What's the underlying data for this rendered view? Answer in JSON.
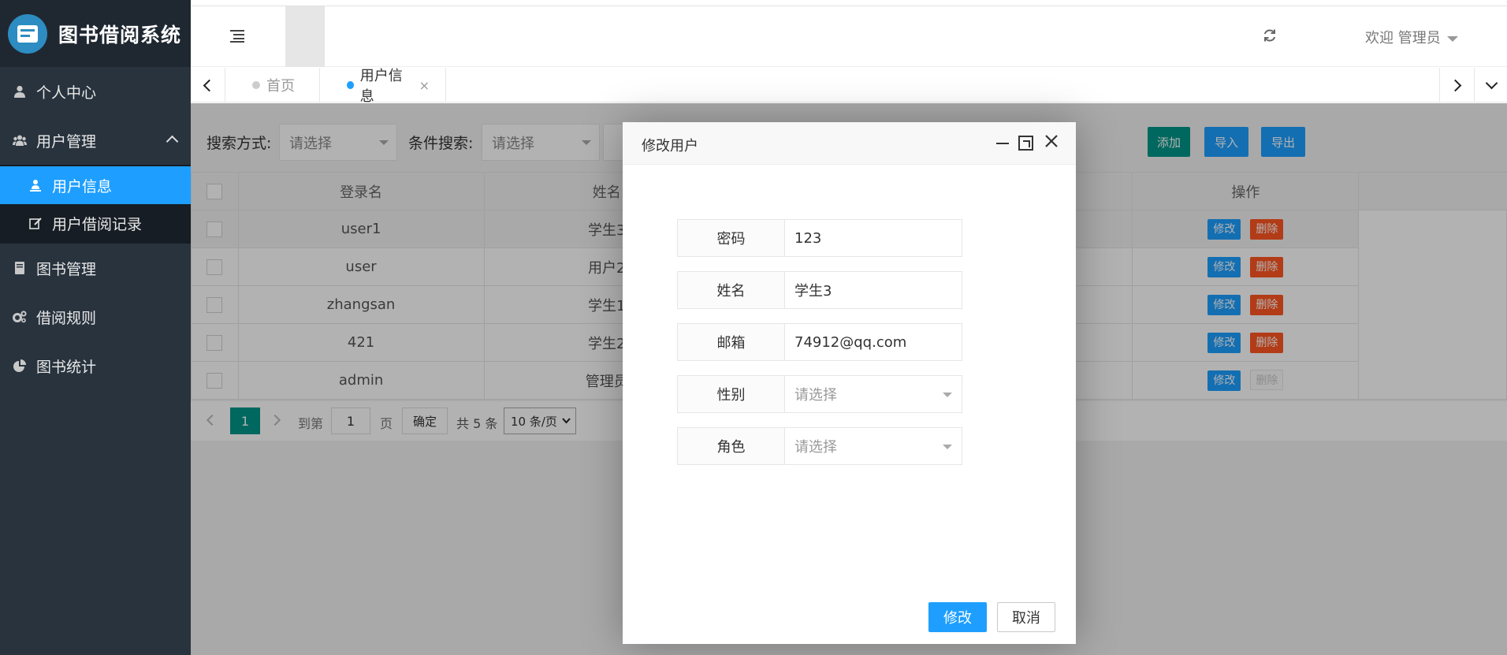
{
  "app": {
    "title": "图书借阅系统"
  },
  "sidebar": {
    "items": [
      {
        "label": "个人中心",
        "icon": "user-icon"
      },
      {
        "label": "用户管理",
        "icon": "users-icon",
        "children": [
          {
            "label": "用户信息",
            "icon": "user-badge-icon",
            "active": true
          },
          {
            "label": "用户借阅记录",
            "icon": "edit-icon"
          }
        ]
      },
      {
        "label": "图书管理",
        "icon": "book-icon"
      },
      {
        "label": "借阅规则",
        "icon": "gears-icon"
      },
      {
        "label": "图书统计",
        "icon": "pie-chart-icon"
      }
    ]
  },
  "header": {
    "welcome": "欢迎 管理员"
  },
  "tabs": [
    {
      "label": "首页",
      "active": false
    },
    {
      "label": "用户信息",
      "active": true,
      "close": "×"
    }
  ],
  "search": {
    "mode_label": "搜索方式:",
    "mode_placeholder": "请选择",
    "cond_label": "条件搜索:",
    "cond_placeholder": "请选择",
    "add": "添加",
    "import": "导入",
    "export": "导出"
  },
  "table": {
    "headers": [
      "登录名",
      "姓名",
      "操作"
    ],
    "rows": [
      {
        "login": "user1",
        "name": "学生3"
      },
      {
        "login": "user",
        "name": "用户2"
      },
      {
        "login": "zhangsan",
        "name": "学生1"
      },
      {
        "login": "421",
        "name": "学生2"
      },
      {
        "login": "admin",
        "name": "管理员",
        "delete_disabled": true
      }
    ],
    "edit_label": "修改",
    "delete_label": "删除"
  },
  "pager": {
    "current": "1",
    "goto_label": "到第",
    "goto_value": "1",
    "page_label": "页",
    "confirm": "确定",
    "total": "共 5 条",
    "page_size": "10 条/页"
  },
  "modal": {
    "title": "修改用户",
    "fields": [
      {
        "label": "密码",
        "value": "123"
      },
      {
        "label": "姓名",
        "value": "学生3"
      },
      {
        "label": "邮箱",
        "value": "74912@qq.com"
      },
      {
        "label": "性别",
        "placeholder": "请选择"
      },
      {
        "label": "角色",
        "placeholder": "请选择"
      }
    ],
    "submit": "修改",
    "cancel": "取消"
  },
  "colors": {
    "sidebar_bg": "#28333e",
    "accent_blue": "#1e9fff",
    "teal": "#009688",
    "danger": "#ff5722"
  }
}
